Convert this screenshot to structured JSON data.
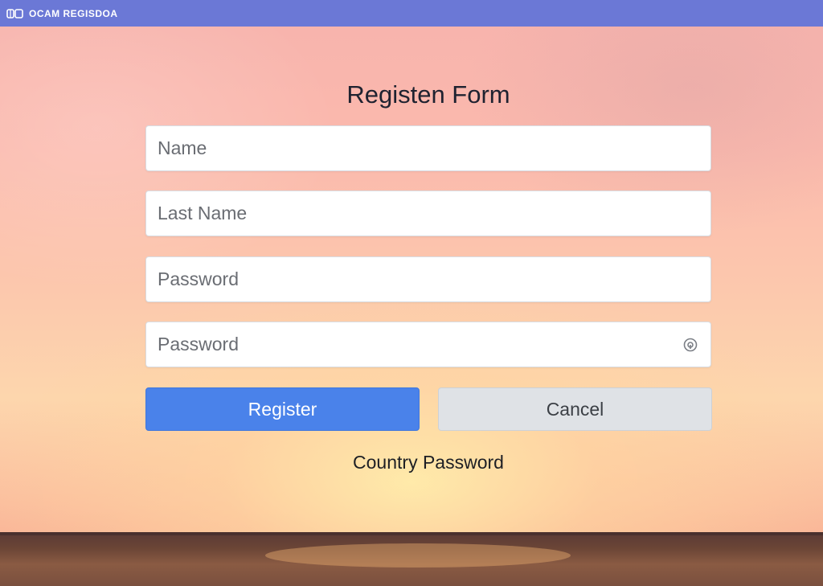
{
  "app": {
    "title": "OCAM REGISDOA"
  },
  "form": {
    "title": "Registen Form",
    "fields": [
      {
        "placeholder": "Name",
        "value": ""
      },
      {
        "placeholder": "Last Name",
        "value": ""
      },
      {
        "placeholder": "Password",
        "value": ""
      },
      {
        "placeholder": "Password",
        "value": ""
      }
    ],
    "register_label": "Register",
    "cancel_label": "Cancel",
    "link_label": "Country Password"
  },
  "colors": {
    "topbar": "#6b78d6",
    "primary_button": "#4a82ea",
    "secondary_button": "#dfe2e6"
  },
  "icons": {
    "app_logo": "app-logo-icon",
    "password_toggle": "eye-icon"
  }
}
